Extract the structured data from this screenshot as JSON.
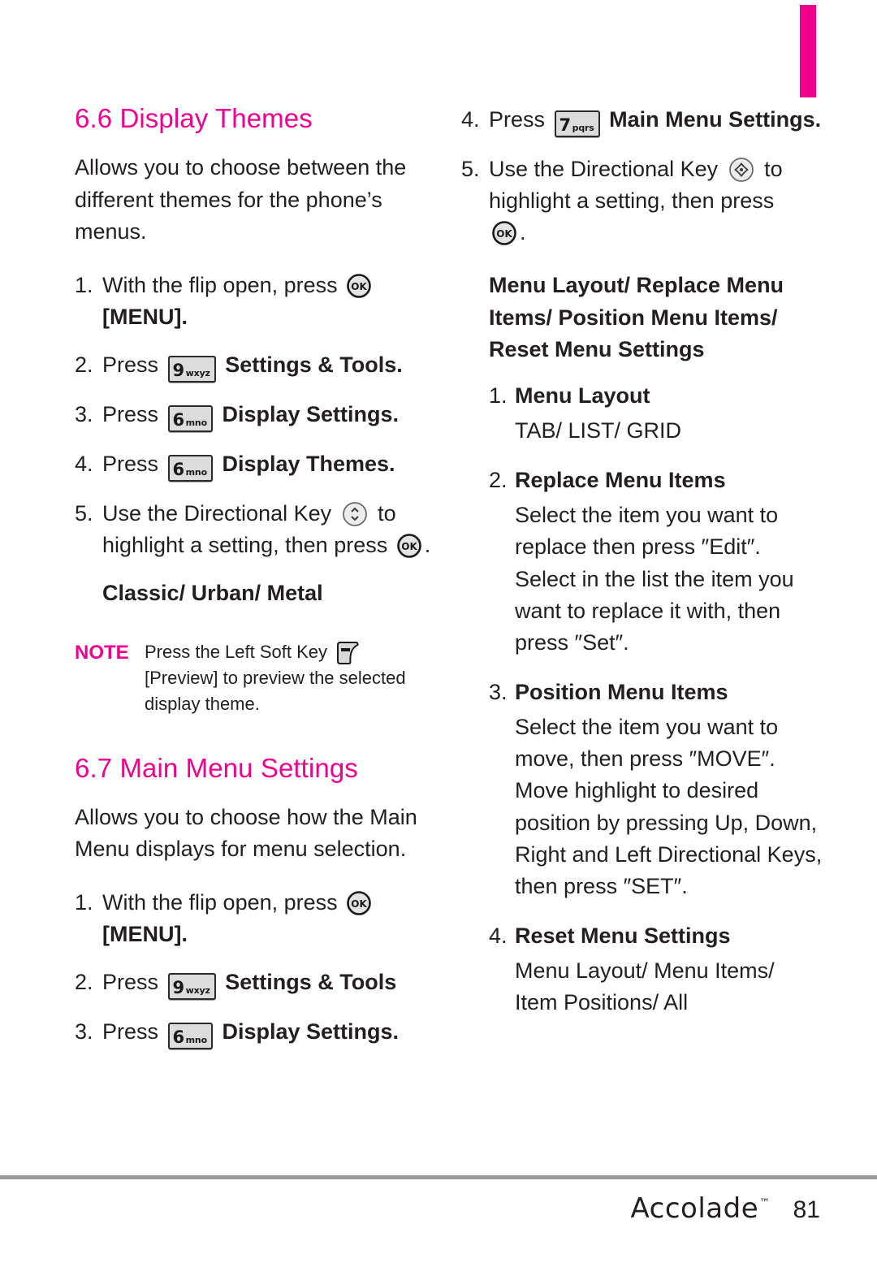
{
  "page": {
    "number": "81",
    "brand": "Accolade",
    "trademark": "™",
    "accent_color": "#ec008c",
    "text_color": "#231f20"
  },
  "left_column": {
    "section_6_6": {
      "title": "6.6 Display Themes",
      "intro": "Allows you to choose between the different themes for the phone’s menus.",
      "steps": [
        {
          "num": "1.",
          "before": "With the flip open, press",
          "key": "ok",
          "after": "",
          "bold_after": "[MENU]."
        },
        {
          "num": "2.",
          "before": "Press",
          "key": "9wxyz",
          "bold_after": "Settings & Tools."
        },
        {
          "num": "3.",
          "before": "Press",
          "key": "6mno",
          "bold_after": "Display Settings."
        },
        {
          "num": "4.",
          "before": "Press",
          "key": "6mno",
          "bold_after": "Display Themes."
        },
        {
          "num": "5.",
          "before": "Use the Directional Key",
          "key": "dir-updown",
          "after": "to highlight a setting, then press",
          "key2": "ok",
          "after2": "."
        }
      ],
      "options": "Classic/ Urban/ Metal",
      "note": {
        "label": "NOTE",
        "line1_before": "Press the Left Soft Key",
        "line1_key": "soft-left",
        "line2": "[Preview] to preview the selected display theme."
      }
    },
    "section_6_7": {
      "title": "6.7 Main Menu Settings",
      "intro": "Allows you to choose how the Main Menu displays for menu selection.",
      "steps": [
        {
          "num": "1.",
          "before": "With the flip open, press",
          "key": "ok",
          "bold_after": "[MENU]."
        },
        {
          "num": "2.",
          "before": "Press",
          "key": "9wxyz",
          "bold_after": "Settings & Tools"
        },
        {
          "num": "3.",
          "before": "Press",
          "key": "6mno",
          "bold_after": "Display Settings."
        }
      ]
    }
  },
  "right_column": {
    "steps": [
      {
        "num": "4.",
        "before": "Press",
        "key": "7pqrs",
        "bold_after": "Main Menu Settings."
      },
      {
        "num": "5.",
        "before": "Use the Directional Key",
        "key": "dir-4way",
        "after": "to highlight a setting, then press",
        "key2": "ok",
        "after2": "."
      }
    ],
    "heading": "Menu Layout/ Replace Menu Items/ Position Menu Items/ Reset Menu Settings",
    "items": [
      {
        "num": "1.",
        "title": "Menu Layout",
        "body": "TAB/ LIST/ GRID"
      },
      {
        "num": "2.",
        "title": "Replace Menu Items",
        "body": "Select the item you want to replace then press ″Edit″. Select in the list the item you want to replace it with, then press ″Set″."
      },
      {
        "num": "3.",
        "title": "Position Menu Items",
        "body": "Select the item you want to move, then press ″MOVE″. Move highlight to desired position by pressing Up, Down, Right and Left Directional Keys, then press ″SET″."
      },
      {
        "num": "4.",
        "title": "Reset Menu Settings",
        "body": "Menu Layout/ Menu Items/ Item Positions/ All"
      }
    ]
  },
  "keys": {
    "k9": {
      "digit": "9",
      "letters": "wxyz"
    },
    "k6": {
      "digit": "6",
      "letters": "mno"
    },
    "k7": {
      "digit": "7",
      "letters": "pqrs"
    },
    "ok_label": "OK"
  }
}
